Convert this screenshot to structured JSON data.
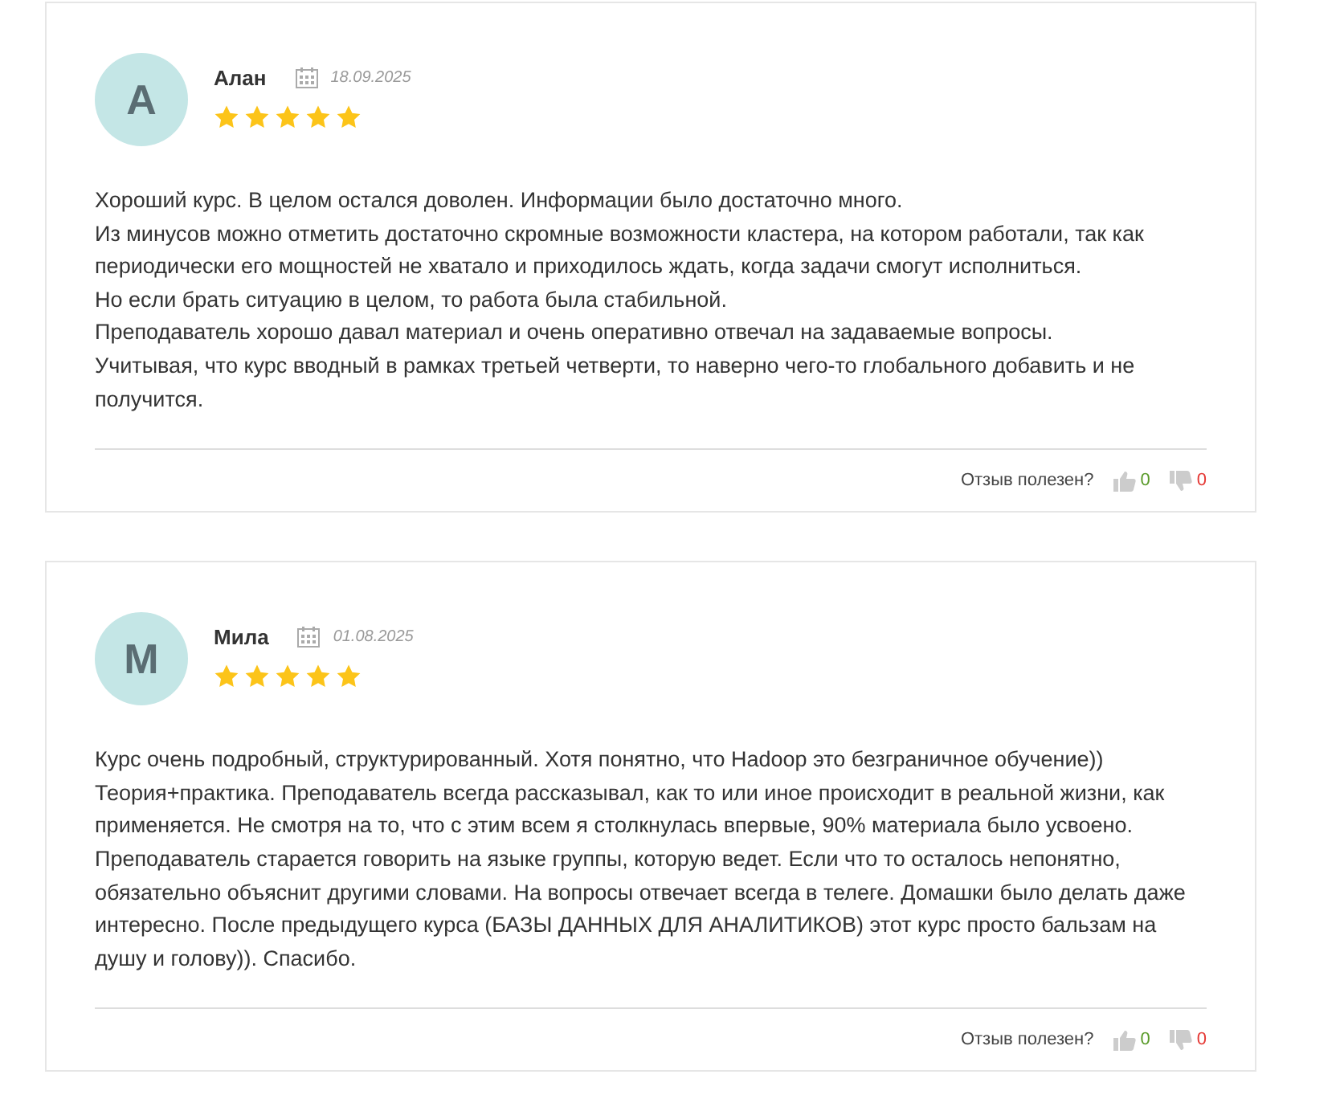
{
  "reviews": [
    {
      "initial": "А",
      "author": "Алан",
      "date": "18.09.2025",
      "stars": 5,
      "paragraphs": [
        "Хороший курс. В целом остался доволен. Информации было достаточно много.",
        "Из минусов можно отметить достаточно скромные возможности кластера, на котором работали, так как периодически его мощностей не хватало и приходилось ждать, когда задачи смогут исполниться.",
        "Но если брать ситуацию в целом, то работа была стабильной.",
        "Преподаватель хорошо давал материал и очень оперативно отвечал на задаваемые вопросы.",
        "Учитывая, что курс вводный в рамках третьей четверти, то наверно чего-то глобального добавить и не получится."
      ],
      "helpful_label": "Отзыв полезен?",
      "likes": "0",
      "dislikes": "0"
    },
    {
      "initial": "М",
      "author": "Мила",
      "date": "01.08.2025",
      "stars": 5,
      "paragraphs": [
        "Курс очень подробный, структурированный. Хотя понятно, что Hadoop это безграничное обучение)) Теория+практика. Преподаватель всегда рассказывал, как то или иное происходит в реальной жизни, как применяется. Не смотря на то, что с этим всем я столкнулась впервые, 90% материала было усвоено. Преподаватель старается говорить на языке группы, которую ведет. Если что то осталось непонятно, обязательно объяснит другими словами. На вопросы отвечает всегда в телеге. Домашки было делать даже интересно. После предыдущего курса (БАЗЫ ДАННЫХ ДЛЯ АНАЛИТИКОВ) этот курс просто бальзам на душу и голову)). Спасибо."
      ],
      "helpful_label": "Отзыв полезен?",
      "likes": "0",
      "dislikes": "0"
    }
  ]
}
